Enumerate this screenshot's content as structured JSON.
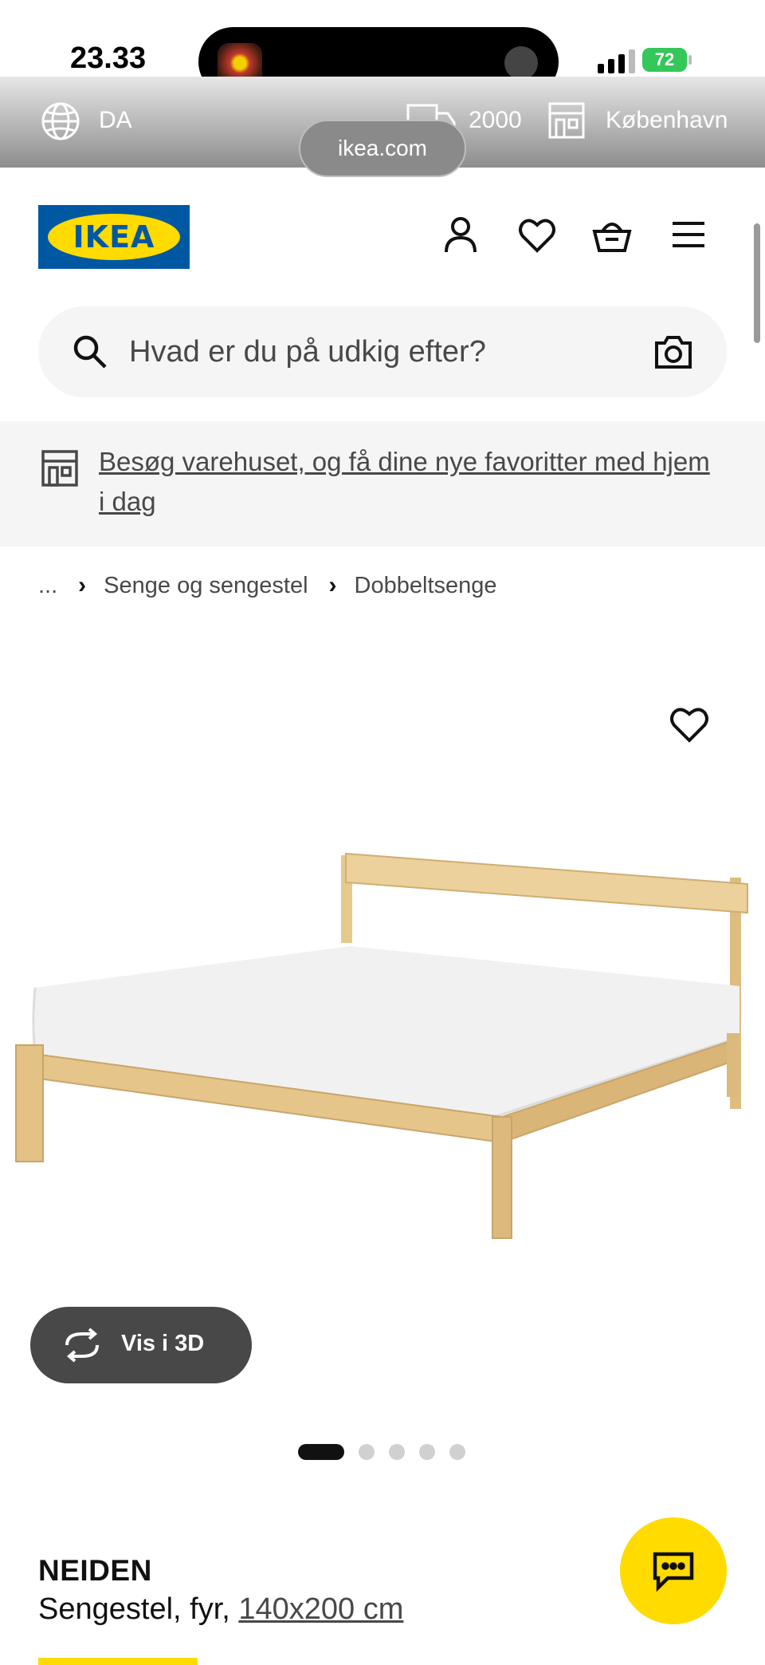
{
  "status_bar": {
    "time": "23.33",
    "battery_percent": "72"
  },
  "top_bar": {
    "language": "DA",
    "postal_code": "2000",
    "store": "København",
    "url": "ikea.com"
  },
  "header": {
    "logo_text": "IKEA",
    "icons": [
      "user-icon",
      "heart-icon",
      "basket-icon",
      "menu-icon"
    ]
  },
  "search": {
    "placeholder": "Hvad er du på udkig efter?"
  },
  "store_banner": {
    "text": "Besøg varehuset, og få dine nye favoritter med hjem i dag"
  },
  "breadcrumb": {
    "ellipsis": "...",
    "items": [
      "Senge og sengestel",
      "Dobbeltsenge"
    ]
  },
  "gallery": {
    "view_3d_label": "Vis i 3D",
    "image_count": 5,
    "active_index": 0
  },
  "product": {
    "name": "NEIDEN",
    "description": "Sengestel, fyr, ",
    "size": "140x200 cm"
  },
  "colors": {
    "brand_blue": "#0058a3",
    "brand_yellow": "#ffdb00",
    "text_grey": "#484848"
  }
}
